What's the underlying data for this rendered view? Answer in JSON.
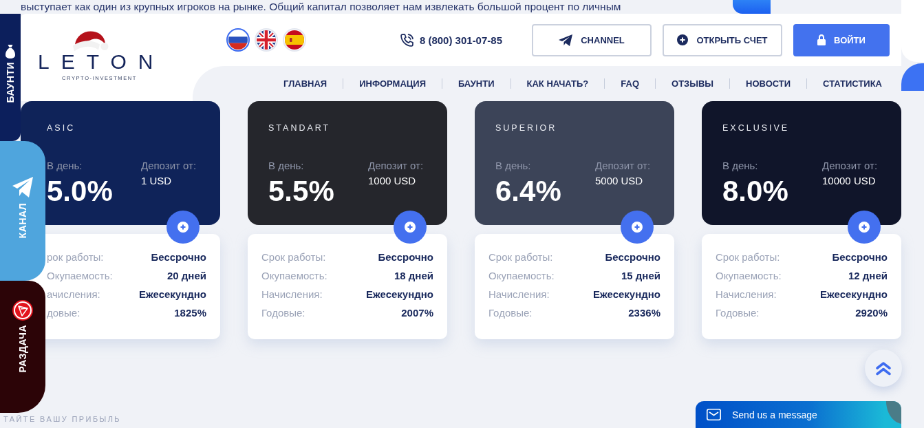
{
  "intro_text": "выступает как один из крупных игроков на рынке. Общий капитал позволяет нам извлекать большой процент по личным",
  "side_tabs": [
    {
      "kind": "bounty",
      "label": "БАУНТИ"
    },
    {
      "kind": "channel",
      "label": "КАНАЛ"
    },
    {
      "kind": "giveaway",
      "label": "РАЗДАЧА"
    }
  ],
  "header": {
    "logo": {
      "name": "LETON",
      "tagline": "CRYPTO-INVESTMENT"
    },
    "languages": [
      {
        "kind": "ru",
        "selected": true
      },
      {
        "kind": "en",
        "selected": false
      },
      {
        "kind": "es",
        "selected": false
      }
    ],
    "phone": "8 (800) 301-07-85",
    "buttons": [
      {
        "kind": "channel",
        "label": "CHANNEL"
      },
      {
        "kind": "signup",
        "label": "ОТКРЫТЬ СЧЕТ"
      },
      {
        "kind": "login",
        "label": "ВОЙТИ"
      }
    ],
    "nav": [
      "ГЛАВНАЯ",
      "ИНФОРМАЦИЯ",
      "БАУНТИ",
      "КАК НАЧАТЬ?",
      "FAQ",
      "ОТЗЫВЫ",
      "НОВОСТИ",
      "СТАТИСТИКА"
    ]
  },
  "plans": [
    {
      "name": "ASIC",
      "color": "#0f2359",
      "per_day_label": "В день:",
      "per_day": "5.0%",
      "deposit_label": "Депозит от:",
      "deposit": "1 USD",
      "details": [
        {
          "label": "рок работы:",
          "value": "Бессрочно"
        },
        {
          "label": "Окупаемость:",
          "value": "20 дней"
        },
        {
          "label": "ачисления:",
          "value": "Ежесекундно"
        },
        {
          "label": "довые:",
          "value": "1825%"
        }
      ]
    },
    {
      "name": "STANDART",
      "color": "#25262c",
      "per_day_label": "В день:",
      "per_day": "5.5%",
      "deposit_label": "Депозит от:",
      "deposit": "1000 USD",
      "details": [
        {
          "label": "Срок работы:",
          "value": "Бессрочно"
        },
        {
          "label": "Окупаемость:",
          "value": "18 дней"
        },
        {
          "label": "Начисления:",
          "value": "Ежесекундно"
        },
        {
          "label": "Годовые:",
          "value": "2007%"
        }
      ]
    },
    {
      "name": "SUPERIOR",
      "color": "#3c4458",
      "per_day_label": "В день:",
      "per_day": "6.4%",
      "deposit_label": "Депозит от:",
      "deposit": "5000 USD",
      "details": [
        {
          "label": "Срок работы:",
          "value": "Бессрочно"
        },
        {
          "label": "Окупаемость:",
          "value": "15 дней"
        },
        {
          "label": "Начисления:",
          "value": "Ежесекундно"
        },
        {
          "label": "Годовые:",
          "value": "2336%"
        }
      ]
    },
    {
      "name": "EXCLUSIVE",
      "color": "#10152a",
      "per_day_label": "В день:",
      "per_day": "8.0%",
      "deposit_label": "Депозит от:",
      "deposit": "10000 USD",
      "details": [
        {
          "label": "Срок работы:",
          "value": "Бессрочно"
        },
        {
          "label": "Окупаемость:",
          "value": "12 дней"
        },
        {
          "label": "Начисления:",
          "value": "Ежесекундно"
        },
        {
          "label": "Годовые:",
          "value": "2920%"
        }
      ]
    }
  ],
  "footer_heading": "ТАЙТЕ ВАШУ ПРИБЫЛЬ",
  "chat_widget": {
    "label": "Send us a message"
  }
}
